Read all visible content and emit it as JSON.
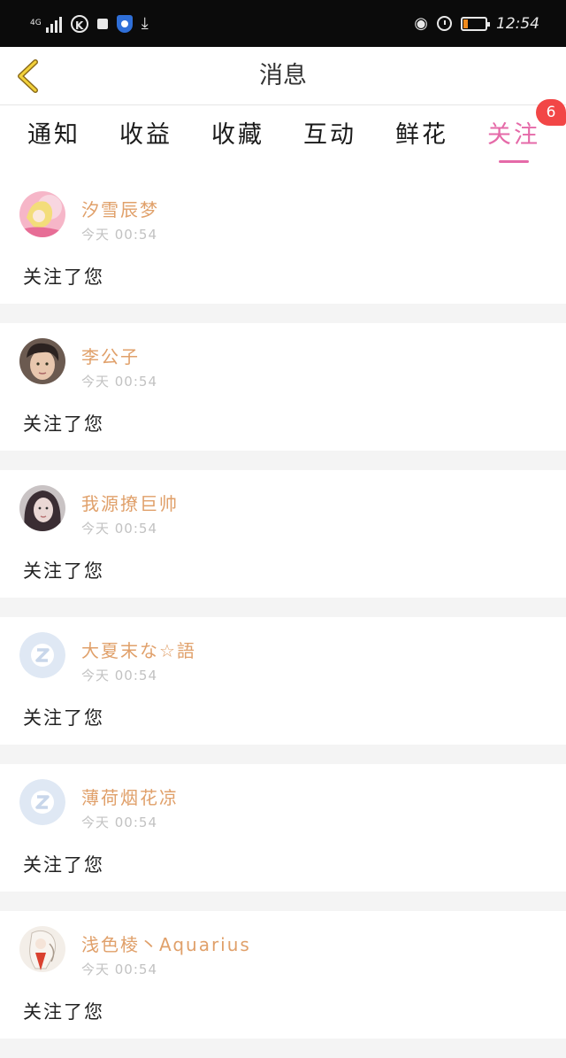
{
  "status_bar": {
    "network": "4G",
    "k_icon_label": "K",
    "time": "12:54"
  },
  "header": {
    "title": "消息",
    "back_icon": "chevron-left-icon"
  },
  "tabs": [
    {
      "label": "通知",
      "active": false
    },
    {
      "label": "收益",
      "active": false
    },
    {
      "label": "收藏",
      "active": false
    },
    {
      "label": "互动",
      "active": false
    },
    {
      "label": "鲜花",
      "active": false
    },
    {
      "label": "关注",
      "active": true,
      "badge": "6"
    }
  ],
  "colors": {
    "accent": "#e56aa8",
    "name": "#e0a06a",
    "badge": "#f24646"
  },
  "notifications": [
    {
      "name": "汐雪辰梦",
      "time": "今天 00:54",
      "action": "关注了您",
      "avatar": "anime-avatar"
    },
    {
      "name": "李公子",
      "time": "今天 00:54",
      "action": "关注了您",
      "avatar": "photo-avatar"
    },
    {
      "name": "我源撩巨帅",
      "time": "今天 00:54",
      "action": "关注了您",
      "avatar": "photo-avatar"
    },
    {
      "name": "大夏末な☆語",
      "time": "今天 00:54",
      "action": "关注了您",
      "avatar": "default-avatar"
    },
    {
      "name": "薄荷烟花凉",
      "time": "今天 00:54",
      "action": "关注了您",
      "avatar": "default-avatar"
    },
    {
      "name": "浅色棱丶Aquarius",
      "time": "今天 00:54",
      "action": "关注了您",
      "avatar": "drawing-avatar"
    }
  ]
}
